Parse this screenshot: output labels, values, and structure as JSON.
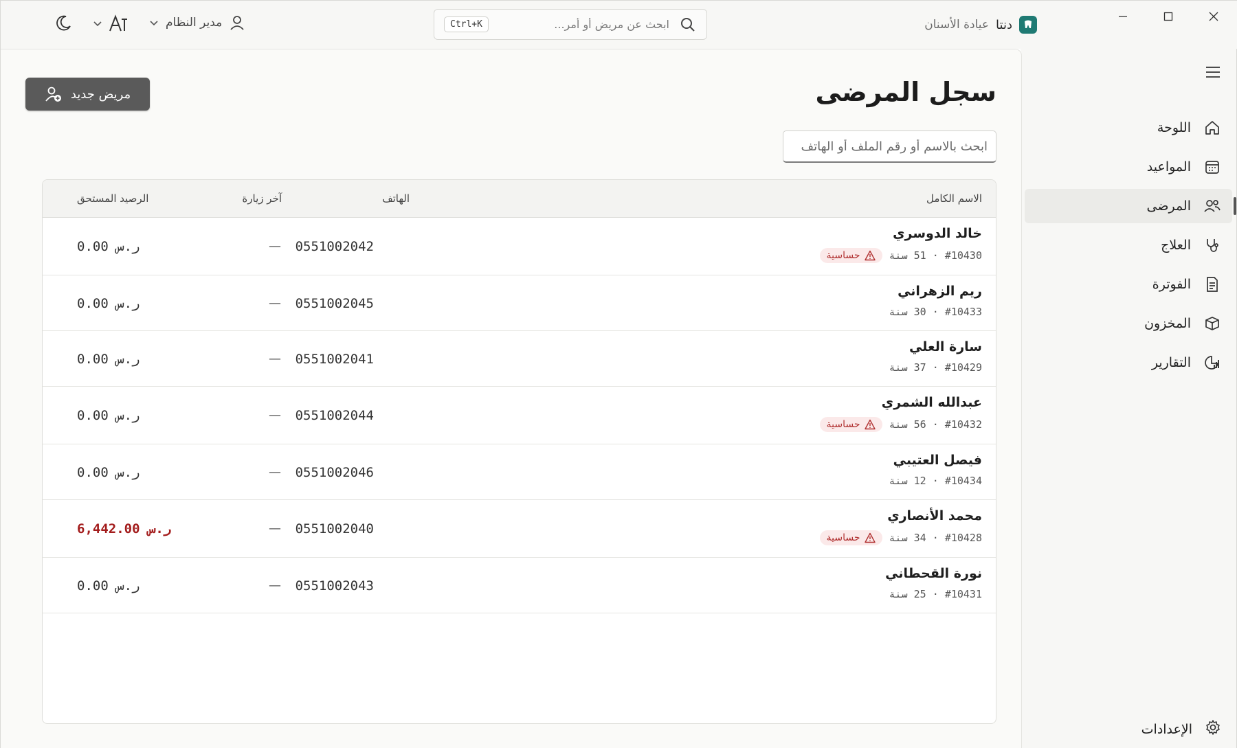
{
  "app": {
    "name": "دنتا",
    "subtitle": "عيادة الأسنان"
  },
  "topbar": {
    "search_placeholder": "ابحث عن مريض أو أمر...",
    "shortcut": "Ctrl+K",
    "user_label": "مدير النظام"
  },
  "sidebar": {
    "items": [
      {
        "label": "اللوحة",
        "icon": "home-icon"
      },
      {
        "label": "المواعيد",
        "icon": "calendar-icon"
      },
      {
        "label": "المرضى",
        "icon": "users-icon",
        "active": true
      },
      {
        "label": "العلاج",
        "icon": "stethoscope-icon"
      },
      {
        "label": "الفوترة",
        "icon": "invoice-icon"
      },
      {
        "label": "المخزون",
        "icon": "box-icon"
      },
      {
        "label": "التقارير",
        "icon": "report-icon"
      }
    ],
    "settings_label": "الإعدادات"
  },
  "page": {
    "title": "سجل المرضى",
    "new_button": "مريض جديد",
    "filter_placeholder": "ابحث بالاسم أو رقم الملف أو الهاتف"
  },
  "table": {
    "headers": {
      "name": "الاسم الكامل",
      "phone": "الهاتف",
      "last_visit": "آخر زيارة",
      "balance": "الرصيد المستحق"
    },
    "allergy_label": "حساسية",
    "rows": [
      {
        "name": "خالد الدوسري",
        "meta": "#10430 · 51 سنة",
        "allergy": true,
        "phone": "0551002042",
        "last_visit": "—",
        "balance": "0.00 ر.س",
        "due": false
      },
      {
        "name": "ريم الزهراني",
        "meta": "#10433 · 30 سنة",
        "allergy": false,
        "phone": "0551002045",
        "last_visit": "—",
        "balance": "0.00 ر.س",
        "due": false
      },
      {
        "name": "سارة العلي",
        "meta": "#10429 · 37 سنة",
        "allergy": false,
        "phone": "0551002041",
        "last_visit": "—",
        "balance": "0.00 ر.س",
        "due": false
      },
      {
        "name": "عبدالله الشمري",
        "meta": "#10432 · 56 سنة",
        "allergy": true,
        "phone": "0551002044",
        "last_visit": "—",
        "balance": "0.00 ر.س",
        "due": false
      },
      {
        "name": "فيصل العتيبي",
        "meta": "#10434 · 12 سنة",
        "allergy": false,
        "phone": "0551002046",
        "last_visit": "—",
        "balance": "0.00 ر.س",
        "due": false
      },
      {
        "name": "محمد الأنصاري",
        "meta": "#10428 · 34 سنة",
        "allergy": true,
        "phone": "0551002040",
        "last_visit": "—",
        "balance": "6,442.00 ر.س",
        "due": true
      },
      {
        "name": "نورة القحطاني",
        "meta": "#10431 · 25 سنة",
        "allergy": false,
        "phone": "0551002043",
        "last_visit": "—",
        "balance": "0.00 ر.س",
        "due": false
      }
    ]
  },
  "colors": {
    "accent": "#1f7a73",
    "danger": "#a31c1c",
    "button": "#5a5a5a"
  }
}
